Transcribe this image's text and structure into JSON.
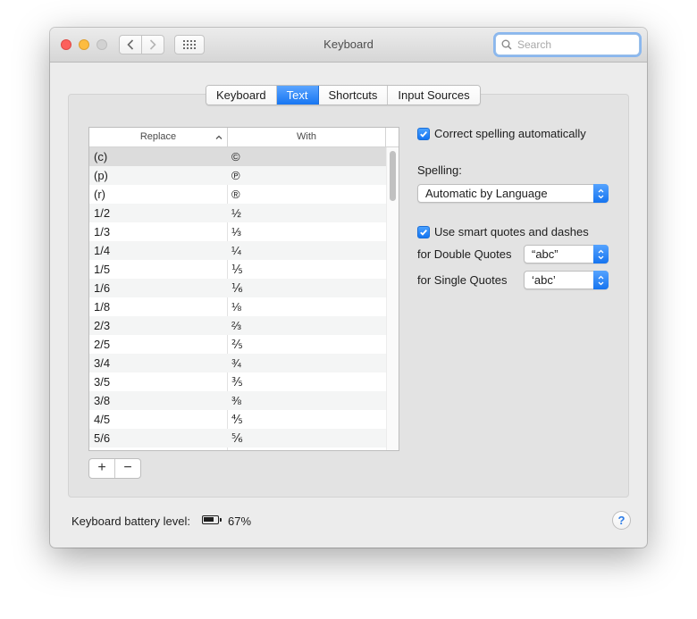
{
  "window": {
    "title": "Keyboard"
  },
  "search": {
    "placeholder": "Search"
  },
  "tabs": [
    {
      "label": "Keyboard",
      "active": false
    },
    {
      "label": "Text",
      "active": true
    },
    {
      "label": "Shortcuts",
      "active": false
    },
    {
      "label": "Input Sources",
      "active": false
    }
  ],
  "table": {
    "columns": {
      "replace": "Replace",
      "with": "With"
    },
    "rows": [
      {
        "replace": "(c)",
        "with": "©"
      },
      {
        "replace": "(p)",
        "with": "℗"
      },
      {
        "replace": "(r)",
        "with": "®"
      },
      {
        "replace": "1/2",
        "with": "½"
      },
      {
        "replace": "1/3",
        "with": "⅓"
      },
      {
        "replace": "1/4",
        "with": "¼"
      },
      {
        "replace": "1/5",
        "with": "⅕"
      },
      {
        "replace": "1/6",
        "with": "⅙"
      },
      {
        "replace": "1/8",
        "with": "⅛"
      },
      {
        "replace": "2/3",
        "with": "⅔"
      },
      {
        "replace": "2/5",
        "with": "⅖"
      },
      {
        "replace": "3/4",
        "with": "¾"
      },
      {
        "replace": "3/5",
        "with": "⅗"
      },
      {
        "replace": "3/8",
        "with": "⅜"
      },
      {
        "replace": "4/5",
        "with": "⅘"
      },
      {
        "replace": "5/6",
        "with": "⅚"
      }
    ],
    "add_label": "+",
    "remove_label": "−"
  },
  "options": {
    "correct_spelling": {
      "label": "Correct spelling automatically",
      "checked": true
    },
    "spelling_label": "Spelling:",
    "spelling_value": "Automatic by Language",
    "smart_quotes": {
      "label": "Use smart quotes and dashes",
      "checked": true
    },
    "double_quotes_label": "for Double Quotes",
    "double_quotes_value": "“abc”",
    "single_quotes_label": "for Single Quotes",
    "single_quotes_value": "‘abc’"
  },
  "battery": {
    "label": "Keyboard battery level:",
    "percent": "67%"
  },
  "help_label": "?",
  "colors": {
    "accent": "#1776f2",
    "close": "#fc605c",
    "minimize": "#fdbc40"
  }
}
